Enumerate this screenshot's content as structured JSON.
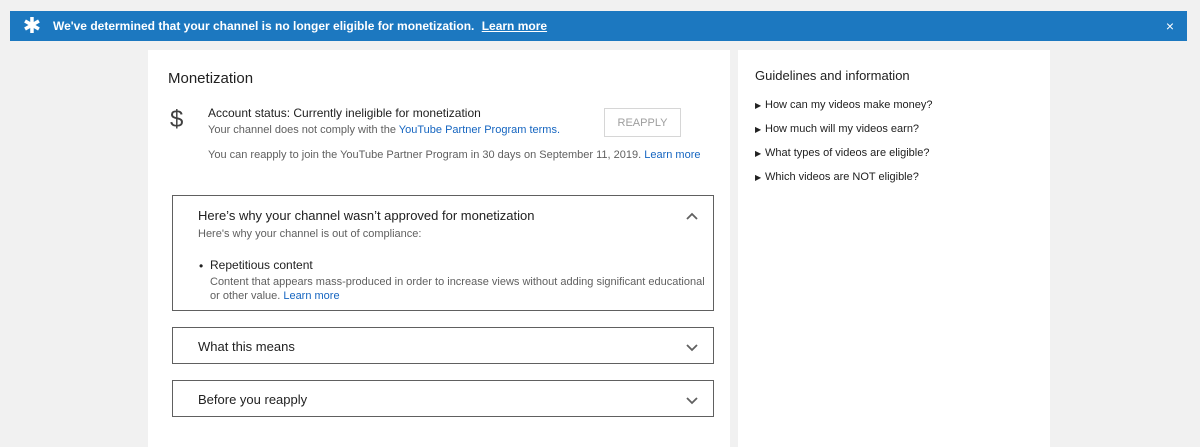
{
  "banner": {
    "icon": "star-icon",
    "message": "We've determined that your channel is no longer eligible for monetization.",
    "link": "Learn more",
    "close": "×"
  },
  "main": {
    "title": "Monetization",
    "status": {
      "icon": "dollar-icon",
      "title": "Account status: Currently ineligible for monetization",
      "sub_prefix": "Your channel does not comply with the ",
      "sub_link": "YouTube Partner Program terms.",
      "reapply_button": "REAPPLY",
      "reapply_note": "You can reapply to join the YouTube Partner Program in 30 days on September 11, 2019.",
      "reapply_link": "Learn more"
    },
    "panels": [
      {
        "title": "Here’s why your channel wasn’t approved for monetization",
        "subtitle": "Here's why your channel is out of compliance:",
        "expanded": true,
        "reason_title": "Repetitious content",
        "reason_desc": "Content that appears mass-produced in order to increase views without adding significant educational or other value.",
        "reason_link": "Learn more"
      },
      {
        "title": "What this means",
        "expanded": false
      },
      {
        "title": "Before you reapply",
        "expanded": false
      }
    ]
  },
  "side": {
    "title": "Guidelines and information",
    "items": [
      "How can my videos make money?",
      "How much will my videos earn?",
      "What types of videos are eligible?",
      "Which videos are NOT eligible?"
    ]
  }
}
